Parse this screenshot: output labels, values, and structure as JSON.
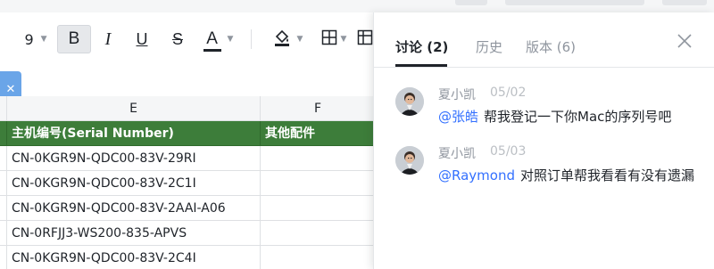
{
  "toolbar": {
    "font_size": "9",
    "bold": "B",
    "italic": "I",
    "underline": "U",
    "strikethrough": "S",
    "font_color": "A"
  },
  "grid": {
    "columns": [
      "E",
      "F"
    ],
    "header_row": [
      "主机编号(Serial Number)",
      "其他配件"
    ],
    "rows": [
      [
        "CN-0KGR9N-QDC00-83V-29RI",
        ""
      ],
      [
        "CN-0KGR9N-QDC00-83V-2C1I",
        ""
      ],
      [
        "CN-0KGR9N-QDC00-83V-2AAI-A06",
        ""
      ],
      [
        "CN-0RFJJ3-WS200-835-APVS",
        ""
      ],
      [
        "CN-0KGR9N-QDC00-83V-2C4I",
        ""
      ]
    ]
  },
  "panel": {
    "tabs": [
      {
        "label": "讨论 (2)"
      },
      {
        "label": "历史"
      },
      {
        "label": "版本 (6)"
      }
    ],
    "comments": [
      {
        "author": "夏小凯",
        "date": "05/02",
        "mention": "@张皓",
        "text": "帮我登记一下你Mac的序列号吧"
      },
      {
        "author": "夏小凯",
        "date": "05/03",
        "mention": "@Raymond",
        "text": "对照订单帮我看看有没有遗漏"
      }
    ]
  },
  "colors": {
    "header_green": "#3d7d3a",
    "mention_blue": "#3370ff",
    "collapse_tab_blue": "#6aa5e8"
  },
  "icons": [
    "chevron-down-icon",
    "fill-color-icon",
    "border-icon",
    "freeze-icon",
    "collapse-arrow-icon",
    "close-icon",
    "avatar"
  ]
}
